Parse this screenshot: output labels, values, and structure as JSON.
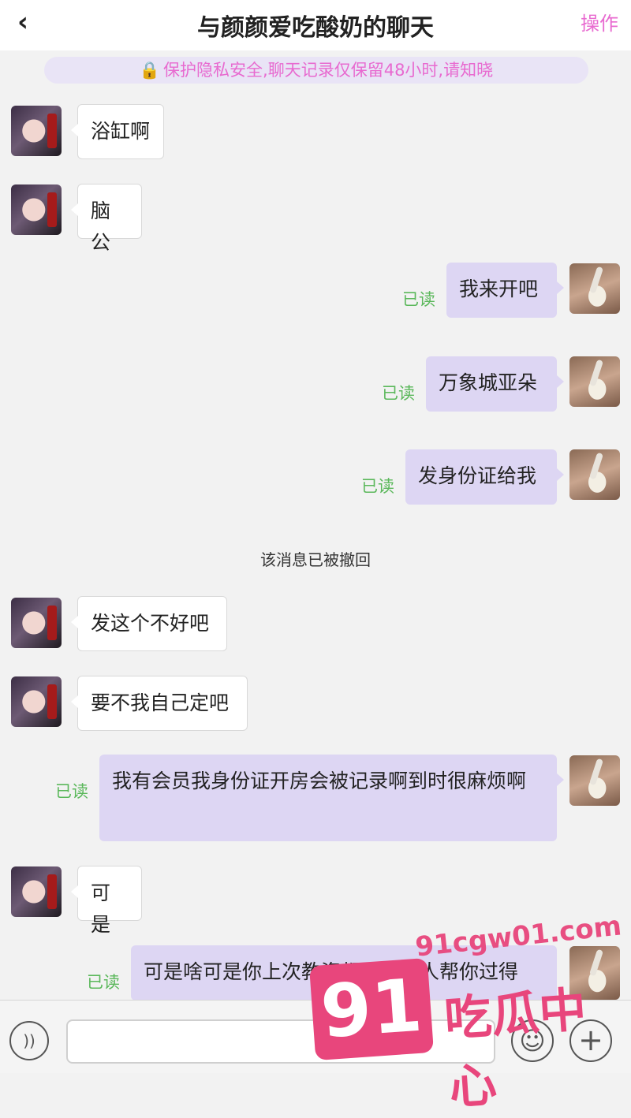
{
  "header": {
    "back_icon": "chevron-left-icon",
    "title": "与颜颜爱吃酸奶的聊天",
    "action_label": "操作"
  },
  "notice": {
    "icon": "lock-icon",
    "text": "保护隐私安全,聊天记录仅保留48小时,请知晓"
  },
  "messages": [
    {
      "from": "her",
      "text": "浴缸啊"
    },
    {
      "from": "her",
      "text": "脑公"
    },
    {
      "from": "me",
      "text": "我来开吧",
      "status": "已读"
    },
    {
      "from": "me",
      "text": "万象城亚朵",
      "status": "已读"
    },
    {
      "from": "me",
      "text": "发身份证给我",
      "status": "已读"
    },
    {
      "from": "system",
      "text": "该消息已被撤回"
    },
    {
      "from": "her",
      "text": "发这个不好吧"
    },
    {
      "from": "her",
      "text": "要不我自己定吧"
    },
    {
      "from": "me",
      "text": "我有会员我身份证开房会被记录啊到时很麻烦啊",
      "status": "已读"
    },
    {
      "from": "her",
      "text": "可是"
    },
    {
      "from": "me",
      "text": "可是啥可是你上次教资都是我找人帮你过得",
      "status": "已读"
    }
  ],
  "input_bar": {
    "voice_icon": "voice-icon",
    "emoji_icon": "emoji-icon",
    "plus_icon": "plus-icon"
  },
  "watermark": {
    "url": "91cgw01.com",
    "number": "91",
    "text": "吃瓜中心"
  }
}
